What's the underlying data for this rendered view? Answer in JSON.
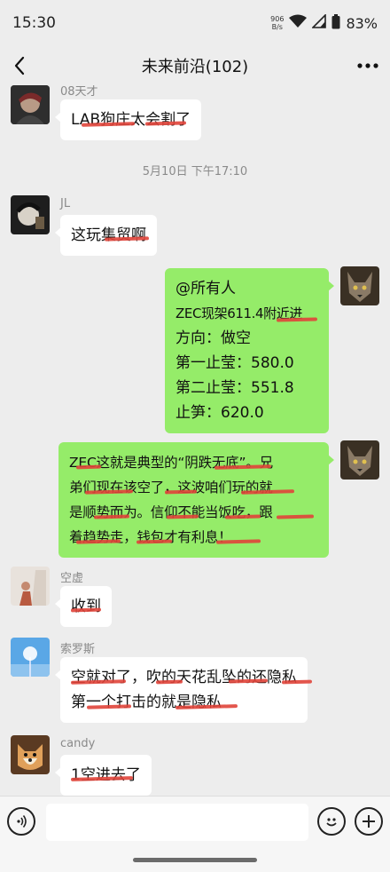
{
  "status_bar": {
    "time": "15:30",
    "net_speed_value": "906",
    "net_speed_unit": "B/s",
    "battery": "83%"
  },
  "nav": {
    "title": "未来前沿(102)"
  },
  "messages": [
    {
      "sender": "08天才",
      "text": "LAB狗庄太会割了"
    },
    {
      "timestamp": "5月10日 下午17:10"
    },
    {
      "sender": "JL",
      "text": "这玩集贸啊"
    },
    {
      "self": true,
      "lines": [
        "@所有人",
        "ZEC现架611.4附近进",
        "方向：做空",
        "第一止莹：580.0",
        "第二止莹：551.8",
        "止笋：620.0"
      ]
    },
    {
      "self": true,
      "lines": [
        "ZEC这就是典型的“阴跌无底”。兄",
        "弟们现在该空了，这波咱们玩的就",
        "是顺势而为。信仰不能当饭吃，跟",
        "着趋势走，钱包才有利息！"
      ]
    },
    {
      "sender": "空虚",
      "text": "收到"
    },
    {
      "sender": "索罗斯",
      "lines": [
        "空就对了，吹的天花乱坠的还隐私",
        "第一个打击的就是隐私"
      ]
    },
    {
      "sender": "candy",
      "text": "1空进去了"
    }
  ],
  "colors": {
    "background": "#ededed",
    "self_bubble": "#95ec69",
    "other_bubble": "#ffffff",
    "strike": "#e0443a"
  },
  "icons": {
    "back": "chevron-left-icon",
    "more": "more-dots-icon",
    "voice": "voice-icon",
    "emoji": "emoji-icon",
    "plus": "plus-icon"
  }
}
